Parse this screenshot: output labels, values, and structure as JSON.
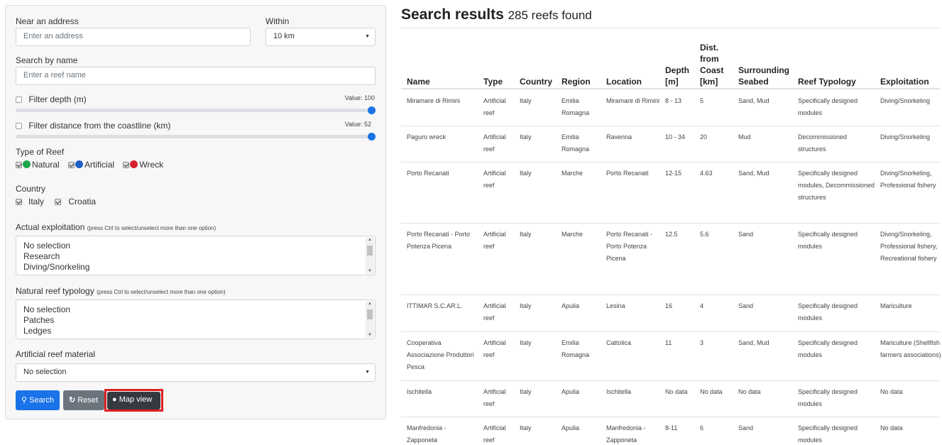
{
  "filters": {
    "near_address_label": "Near an address",
    "near_address_placeholder": "Enter an address",
    "within_label": "Within",
    "within_value": "10 km",
    "name_label": "Search by name",
    "name_placeholder": "Enter a reef name",
    "depth_label": "Filter depth (m)",
    "depth_value_text": "Value: 100",
    "depth_value": 100,
    "distance_label": "Filter distance from the coastline (km)",
    "distance_value_text": "Value: 52",
    "distance_value": 52,
    "reef_type_label": "Type of Reef",
    "reef_types": [
      {
        "label": "Natural",
        "color": "#1ea84a",
        "checked": true
      },
      {
        "label": "Artificial",
        "color": "#1f5fc4",
        "checked": true
      },
      {
        "label": "Wreck",
        "color": "#d6202f",
        "checked": true
      }
    ],
    "country_label": "Country",
    "countries": [
      {
        "label": "Italy",
        "checked": true
      },
      {
        "label": "Croatia",
        "checked": true
      }
    ],
    "exploitation_label": "Actual exploitation",
    "exploitation_note": "(press Ctrl to select/unselect more than one option)",
    "exploitation_options": [
      "No selection",
      "Research",
      "Diving/Snorkeling"
    ],
    "typology_label": "Natural reef typology",
    "typology_note": "(press Ctrl to select/unselect more than one option)",
    "typology_options": [
      "No selection",
      "Patches",
      "Ledges"
    ],
    "material_label": "Artificial reef material",
    "material_value": "No selection"
  },
  "buttons": {
    "search": "Search",
    "reset": "Reset",
    "map_view": "Map view"
  },
  "results": {
    "title": "Search results",
    "count": "285 reefs found",
    "columns": [
      "Name",
      "Type",
      "Country",
      "Region",
      "Location",
      "Depth [m]",
      "Dist. from Coast [km]",
      "Surrounding Seabed",
      "Reef Typology",
      "Exploitation"
    ],
    "rows": [
      [
        "Miramare di Rimini",
        "Artificial reef",
        "Italy",
        "Emilia Romagna",
        "Miramare di Rimini",
        "8 - 13",
        "5",
        "Sand, Mud",
        "Specifically designed modules",
        "Diving/Snorkeling"
      ],
      [
        "Paguro wreck",
        "Artificial reef",
        "Italy",
        "Emilia Romagna",
        "Ravenna",
        "10 - 34",
        "20",
        "Mud",
        "Decommissioned structures",
        "Diving/Snorkeling"
      ],
      [
        "Porto Recanati",
        "Artificial reef",
        "Italy",
        "Marche",
        "Porto Recanati",
        "12-15",
        "4.63",
        "Sand, Mud",
        "Specifically designed modules, Decommissioned structures",
        "Diving/Snorkeling, Professional fishery"
      ],
      [
        "Porto Recanati - Porto Potenza Picena",
        "Artificial reef",
        "Italy",
        "Marche",
        "Porto Recanati - Porto Potenza Picena",
        "12.5",
        "5.6",
        "Sand",
        "Specifically designed modules",
        "Diving/Snorkeling, Professional fishery, Recreational fishery"
      ],
      [
        "ITTIMAR S.C.AR.L.",
        "Artificial reef",
        "Italy",
        "Apulia",
        "Lesina",
        "16",
        "4",
        "Sand",
        "Specifically designed modules",
        "Mariculture"
      ],
      [
        "Cooperativa Associazione Produttori Pesca",
        "Artificial reef",
        "Italy",
        "Emilia Romagna",
        "Cattolica",
        "11",
        "3",
        "Sand, Mud",
        "Specifically designed modules",
        "Mariculture (Shellfish farmers associations)"
      ],
      [
        "Ischitella",
        "Artificial reef",
        "Italy",
        "Apulia",
        "Ischitella",
        "No data",
        "No data",
        "No data",
        "Specifically designed modules",
        "No data"
      ],
      [
        "Manfredonia - Zapponeta",
        "Artificial reef",
        "Italy",
        "Apulia",
        "Manfredonia - Zapponeta",
        "8-11",
        "6",
        "Sand",
        "Specifically designed modules",
        "No data"
      ]
    ]
  }
}
